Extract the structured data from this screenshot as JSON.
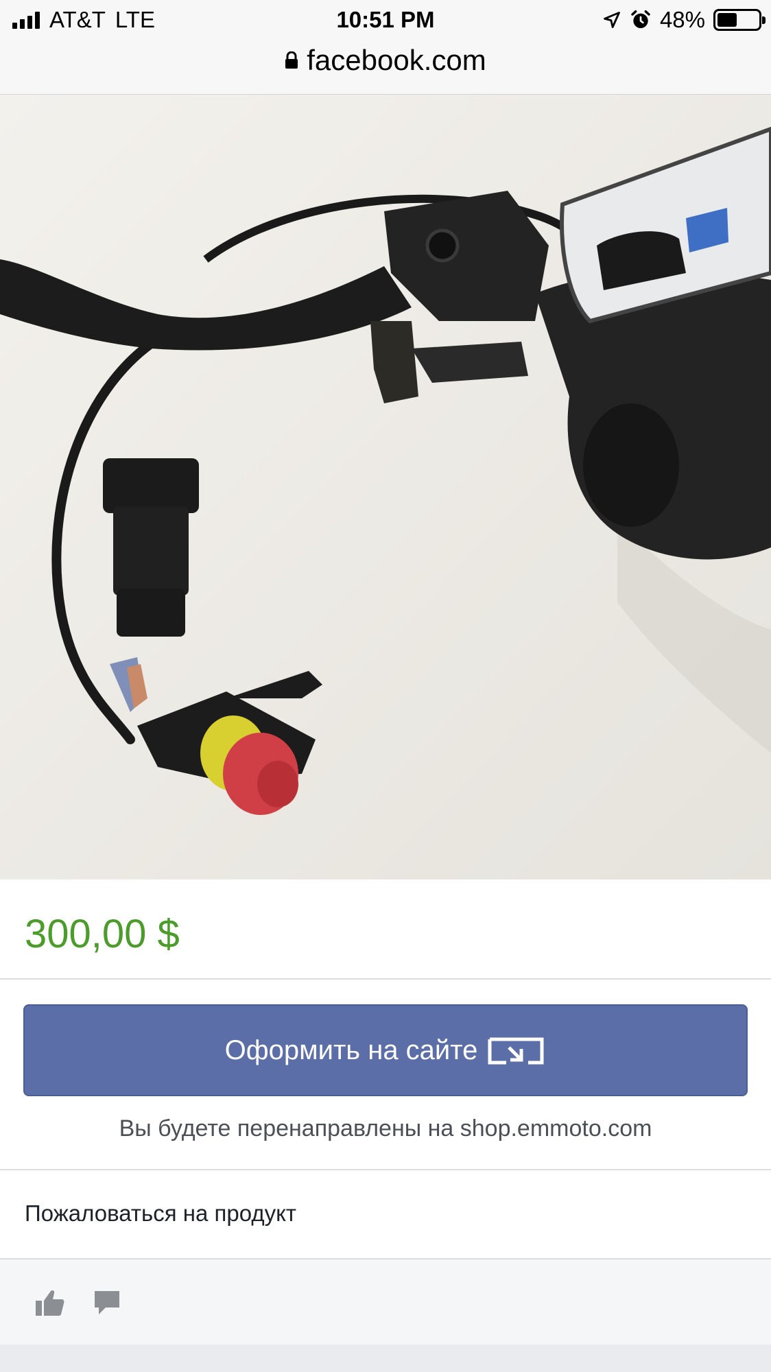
{
  "status_bar": {
    "carrier": "AT&T",
    "network": "LTE",
    "time": "10:51 PM",
    "battery": "48%",
    "battery_level": 0.48,
    "icons": [
      "signal-icon",
      "location-icon",
      "alarm-icon",
      "battery-icon"
    ]
  },
  "address_bar": {
    "domain": "facebook.com",
    "icon": "lock-icon"
  },
  "product": {
    "price": "300,00 $",
    "checkout_label": "Оформить на сайте",
    "redirect_note": "Вы будете перенаправлены на shop.emmoto.com",
    "report_label": "Пожаловаться на продукт",
    "share_icon": "share-arrow-icon"
  },
  "actions": {
    "icons": [
      "thumbs-up-icon",
      "comment-icon"
    ]
  },
  "colors": {
    "price_green": "#4b9c2a",
    "button_blue": "#5b6ea7",
    "divider": "#dcdde0"
  }
}
